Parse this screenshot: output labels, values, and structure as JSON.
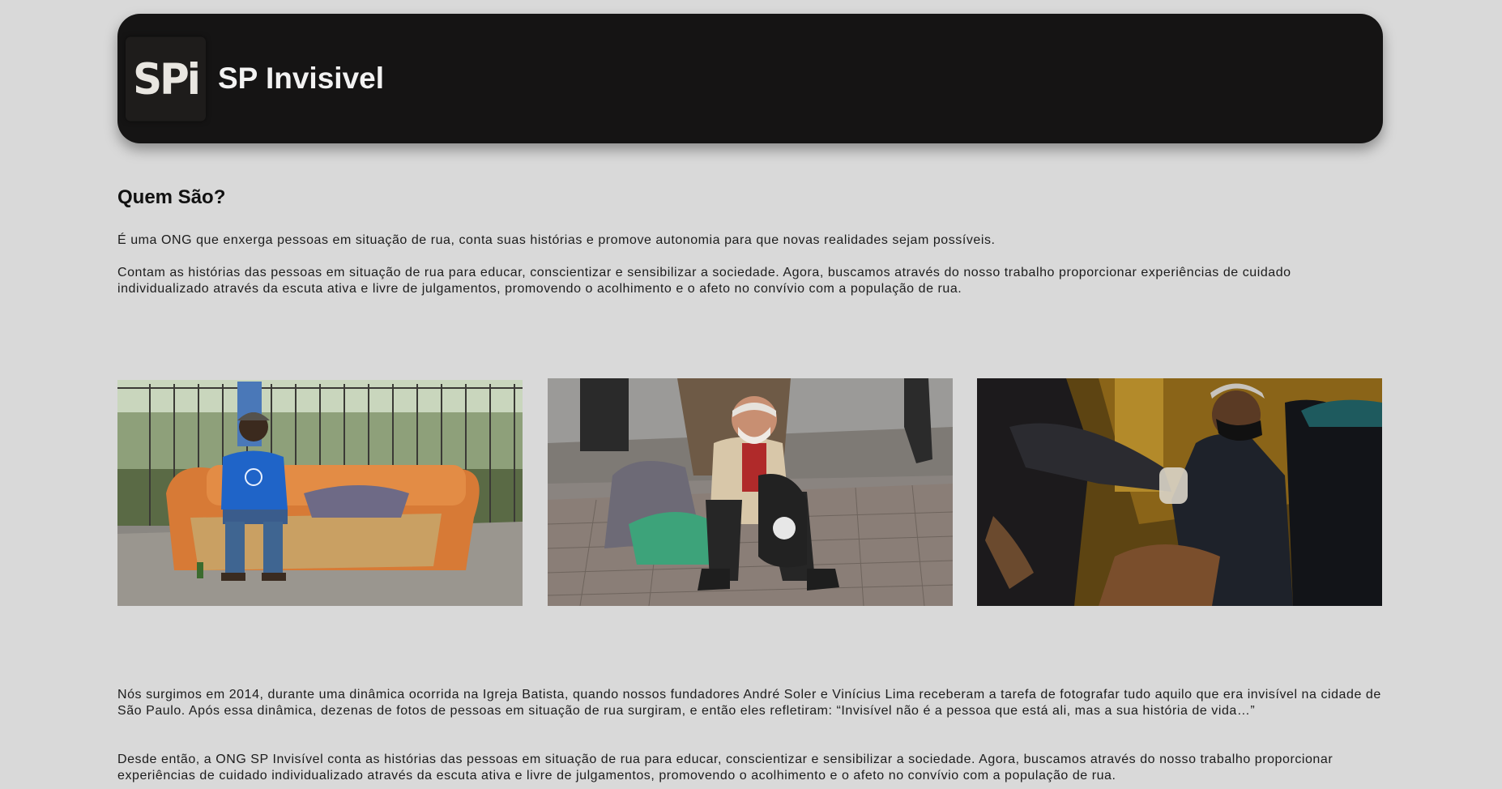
{
  "header": {
    "logo_text": "SPi",
    "title": "SP Invisivel"
  },
  "about": {
    "heading": "Quem São?",
    "paragraph1": "É uma ONG que enxerga pessoas em situação de rua, conta suas histórias e promove autonomia para que novas realidades sejam possíveis.",
    "paragraph2": "Contam as histórias das pessoas em situação de rua para educar, conscientizar e sensibilizar a sociedade. Agora, buscamos através do nosso trabalho proporcionar experiências de cuidado individualizado através da escuta ativa e livre de julgamentos, promovendo o acolhimento e o afeto no convívio com a população de rua.",
    "paragraph3": "Nós surgimos em 2014, durante uma dinâmica ocorrida na Igreja Batista, quando nossos fundadores André Soler e Vinícius Lima receberam a tarefa de fotografar tudo aquilo que era invisível na cidade de São Paulo. Após essa dinâmica, dezenas de fotos de pessoas em situação de rua surgiram, e então eles refletiram: “Invisível não é a pessoa que está ali, mas a sua história de vida…”",
    "paragraph4": "Desde então, a ONG SP Invisível conta as histórias das pessoas em situação de rua para educar, conscientizar e sensibilizar a sociedade. Agora, buscamos através do nosso trabalho proporcionar experiências de cuidado individualizado através da escuta ativa e livre de julgamentos, promovendo o acolhimento e o afeto no convívio com a população de rua."
  },
  "colors": {
    "background": "#d9d9d9",
    "header_bg": "#151414",
    "header_text": "#f2f2f2"
  }
}
